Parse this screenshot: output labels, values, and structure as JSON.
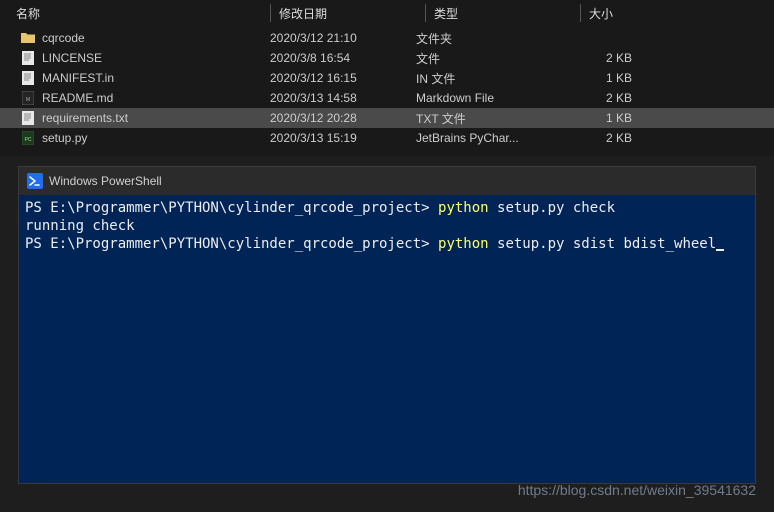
{
  "explorer": {
    "columns": {
      "name": "名称",
      "date": "修改日期",
      "type": "类型",
      "size": "大小"
    },
    "rows": [
      {
        "icon": "folder",
        "name": "cqrcode",
        "date": "2020/3/12 21:10",
        "type": "文件夹",
        "size": "",
        "selected": false
      },
      {
        "icon": "file-txt",
        "name": "LINCENSE",
        "date": "2020/3/8 16:54",
        "type": "文件",
        "size": "2 KB",
        "selected": false
      },
      {
        "icon": "file-txt",
        "name": "MANIFEST.in",
        "date": "2020/3/12 16:15",
        "type": "IN 文件",
        "size": "1 KB",
        "selected": false
      },
      {
        "icon": "file-md",
        "name": "README.md",
        "date": "2020/3/13 14:58",
        "type": "Markdown File",
        "size": "2 KB",
        "selected": false
      },
      {
        "icon": "file-txt",
        "name": "requirements.txt",
        "date": "2020/3/12 20:28",
        "type": "TXT 文件",
        "size": "1 KB",
        "selected": true
      },
      {
        "icon": "file-py",
        "name": "setup.py",
        "date": "2020/3/13 15:19",
        "type": "JetBrains PyChar...",
        "size": "2 KB",
        "selected": false
      }
    ]
  },
  "terminal": {
    "title": "Windows PowerShell",
    "lines": [
      {
        "prompt": "PS E:\\Programmer\\PYTHON\\cylinder_qrcode_project> ",
        "cmd_head": "python",
        "cmd_rest": " setup.py check"
      },
      {
        "text": "running check"
      },
      {
        "prompt": "PS E:\\Programmer\\PYTHON\\cylinder_qrcode_project> ",
        "cmd_head": "python",
        "cmd_rest": " setup.py sdist bdist_wheel",
        "cursor": true
      }
    ]
  },
  "watermark": "https://blog.csdn.net/weixin_39541632"
}
